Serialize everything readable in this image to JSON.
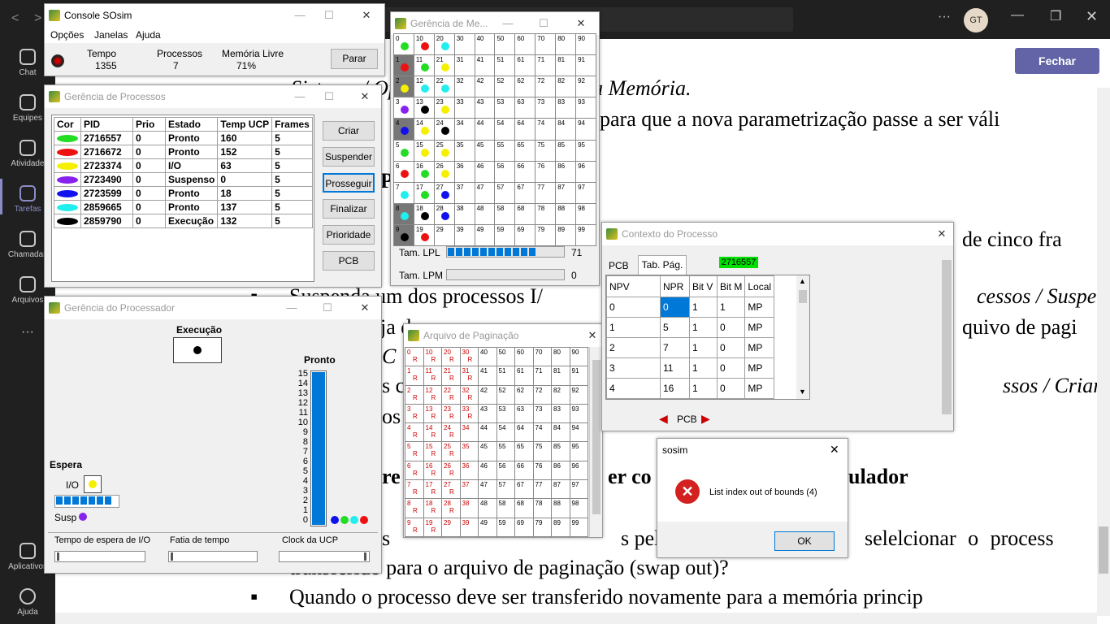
{
  "teams": {
    "rail": [
      {
        "label": "Chat",
        "icon": "chat-icon"
      },
      {
        "label": "Equipes",
        "icon": "teams-icon"
      },
      {
        "label": "Atividade",
        "icon": "bell-icon"
      },
      {
        "label": "Tarefas",
        "icon": "tasks-icon"
      },
      {
        "label": "Chamadas",
        "icon": "phone-icon"
      },
      {
        "label": "Arquivos",
        "icon": "file-icon"
      },
      {
        "label": "Aplicativos",
        "icon": "apps-icon"
      },
      {
        "label": "Ajuda",
        "icon": "help-icon"
      }
    ],
    "avatar": "GT",
    "close_button": "Fechar",
    "more": "···"
  },
  "document": {
    "lines": [
      "Sistema / Opções do Sistema na guia Memória.",
      "para que a nova parametrização passe a ser váli",
      "Pr",
      "de cinco fra",
      "Suspenda um dos processos I/",
      "cessos / Suspe",
      "ja de",
      "quivo de pagi",
      "C",
      "ssos / Criar.",
      "s c",
      "os",
      "re",
      "er co",
      "ulador",
      "s",
      "s pel",
      "selelcionar o process",
      "transferido para o arquivo de paginação (swap out)?",
      "Quando o processo deve ser transferido novamente para a memória princip"
    ],
    "bullet": "▪"
  },
  "console": {
    "title": "Console SOsim",
    "menu": [
      "Opções",
      "Janelas",
      "Ajuda"
    ],
    "fields": [
      {
        "label": "Tempo",
        "value": "1355"
      },
      {
        "label": "Processos",
        "value": "7"
      },
      {
        "label": "Memória Livre",
        "value": "71%"
      }
    ],
    "stop_button": "Parar"
  },
  "process_mgr": {
    "title": "Gerência de Processos",
    "headers": [
      "Cor",
      "PID",
      "Prio",
      "Estado",
      "Temp UCP",
      "Frames"
    ],
    "rows": [
      {
        "color": "#22dd22",
        "pid": "2716557",
        "prio": "0",
        "state": "Pronto",
        "cpu": "160",
        "frames": "5"
      },
      {
        "color": "#ee1111",
        "pid": "2716672",
        "prio": "0",
        "state": "Pronto",
        "cpu": "152",
        "frames": "5"
      },
      {
        "color": "#f5f000",
        "pid": "2723374",
        "prio": "0",
        "state": "I/O",
        "cpu": "63",
        "frames": "5"
      },
      {
        "color": "#8822ee",
        "pid": "2723490",
        "prio": "0",
        "state": "Suspenso",
        "cpu": "0",
        "frames": "5"
      },
      {
        "color": "#1111ee",
        "pid": "2723599",
        "prio": "0",
        "state": "Pronto",
        "cpu": "18",
        "frames": "5"
      },
      {
        "color": "#22eeee",
        "pid": "2859665",
        "prio": "0",
        "state": "Pronto",
        "cpu": "137",
        "frames": "5"
      },
      {
        "color": "#000000",
        "pid": "2859790",
        "prio": "0",
        "state": "Execução",
        "cpu": "132",
        "frames": "5"
      }
    ],
    "buttons": [
      "Criar",
      "Suspender",
      "Prosseguir",
      "Finalizar",
      "Prioridade",
      "PCB"
    ]
  },
  "cpu_mgr": {
    "title": "Gerência do Processador",
    "exec_label": "Execução",
    "ready_label": "Pronto",
    "wait_label": "Espera",
    "io_label": "I/O",
    "susp_label": "Susp",
    "ready_scale": [
      "15",
      "14",
      "13",
      "12",
      "11",
      "10",
      "9",
      "8",
      "7",
      "6",
      "5",
      "4",
      "3",
      "2",
      "1",
      "0"
    ],
    "ready_level": 16,
    "ready_dots": [
      "#1111ee",
      "#22dd22",
      "#22eeee",
      "#ee1111"
    ],
    "io_dot": "#f5f000",
    "susp_dot": "#8822ee",
    "exec_dot": "#000000",
    "io_progress": 0.9,
    "sliders": [
      "Tempo de espera de I/O",
      "Fatia de tempo",
      "Clock da UCP"
    ]
  },
  "memory_mgr": {
    "title": "Gerência de Me...",
    "lpl_label": "Tam. LPL",
    "lpl_value": "71",
    "lpl_fill": 0.71,
    "lpm_label": "Tam. LPM",
    "lpm_value": "0",
    "lpm_fill": 0
  },
  "paging_file": {
    "title": "Arquivo de Paginação"
  },
  "context": {
    "title": "Contexto do Processo",
    "tabs": [
      "PCB",
      "Tab. Pág."
    ],
    "pid": "2716557",
    "headers": [
      "NPV",
      "NPR",
      "Bit V",
      "Bit M",
      "Local"
    ],
    "rows": [
      [
        "0",
        "0",
        "1",
        "1",
        "MP"
      ],
      [
        "1",
        "5",
        "1",
        "0",
        "MP"
      ],
      [
        "2",
        "7",
        "1",
        "0",
        "MP"
      ],
      [
        "3",
        "11",
        "1",
        "0",
        "MP"
      ],
      [
        "4",
        "16",
        "1",
        "0",
        "MP"
      ]
    ],
    "pcb_nav": "PCB"
  },
  "dialog": {
    "title": "sosim",
    "message": "List index out of bounds (4)",
    "ok": "OK"
  }
}
